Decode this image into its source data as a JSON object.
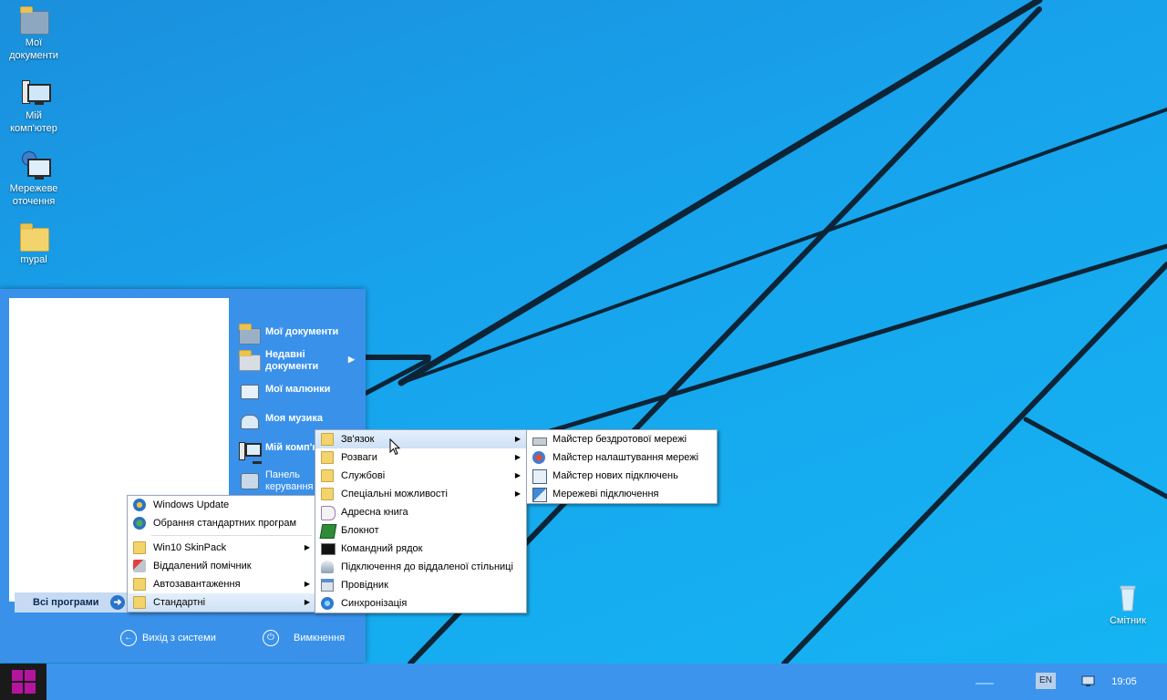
{
  "desktop": {
    "icons": [
      {
        "label": "Мої\nдокументи",
        "icon": "documents-folder-icon"
      },
      {
        "label": "Мій\nкомп'ютер",
        "icon": "computer-icon"
      },
      {
        "label": "Мережеве\nоточення",
        "icon": "network-icon"
      },
      {
        "label": "mypal",
        "icon": "folder-icon"
      }
    ],
    "recycle_bin": {
      "label": "Смітник",
      "icon": "recycle-bin-icon"
    }
  },
  "start_menu": {
    "all_programs_label": "Всі програми",
    "places": [
      {
        "label": "Мої документи",
        "icon": "documents-folder-icon"
      },
      {
        "label": "Недавні документи",
        "icon": "recent-documents-icon",
        "has_submenu": true
      },
      {
        "label": "Мої малюнки",
        "icon": "pictures-icon"
      },
      {
        "label": "Моя музика",
        "icon": "music-icon"
      },
      {
        "label": "Мій комп'ютер",
        "icon": "computer-icon"
      },
      {
        "label": "Панель керування",
        "icon": "control-panel-icon"
      }
    ],
    "logoff_label": "Вихід з системи",
    "shutdown_label": "Вимкнення"
  },
  "all_programs_menu": {
    "items": [
      {
        "label": "Windows Update",
        "icon": "windows-update-icon"
      },
      {
        "label": "Обрання стандартних програм",
        "icon": "default-programs-icon"
      },
      {
        "label": "Win10 SkinPack",
        "icon": "folder-icon",
        "has_submenu": true
      },
      {
        "label": "Віддалений помічник",
        "icon": "remote-assistance-icon"
      },
      {
        "label": "Автозавантаження",
        "icon": "folder-icon",
        "has_submenu": true
      },
      {
        "label": "Стандартні",
        "icon": "folder-icon",
        "has_submenu": true,
        "selected": true
      }
    ]
  },
  "accessories_menu": {
    "items": [
      {
        "label": "Зв'язок",
        "icon": "folder-icon",
        "has_submenu": true,
        "selected": true
      },
      {
        "label": "Розваги",
        "icon": "folder-icon",
        "has_submenu": true
      },
      {
        "label": "Службові",
        "icon": "folder-icon",
        "has_submenu": true
      },
      {
        "label": "Спеціальні можливості",
        "icon": "folder-icon",
        "has_submenu": true
      },
      {
        "label": "Адресна книга",
        "icon": "address-book-icon"
      },
      {
        "label": "Блокнот",
        "icon": "notepad-icon"
      },
      {
        "label": "Командний рядок",
        "icon": "command-prompt-icon"
      },
      {
        "label": "Підключення до віддаленої стільниці",
        "icon": "remote-desktop-icon"
      },
      {
        "label": "Провідник",
        "icon": "explorer-icon"
      },
      {
        "label": "Синхронізація",
        "icon": "sync-icon"
      }
    ]
  },
  "communications_menu": {
    "items": [
      {
        "label": "Майстер бездротової мережі",
        "icon": "wireless-network-icon"
      },
      {
        "label": "Майстер налаштування мережі",
        "icon": "network-setup-icon"
      },
      {
        "label": "Майстер нових підключень",
        "icon": "new-connection-icon"
      },
      {
        "label": "Мережеві підключення",
        "icon": "network-connections-icon"
      }
    ]
  },
  "taskbar": {
    "language": "EN",
    "clock": "19:05"
  },
  "colors": {
    "wallpaper": "#17a3ec",
    "start_menu": "#3a91ea",
    "taskbar": "#3d94ec",
    "start_logo": "#b4149e"
  }
}
